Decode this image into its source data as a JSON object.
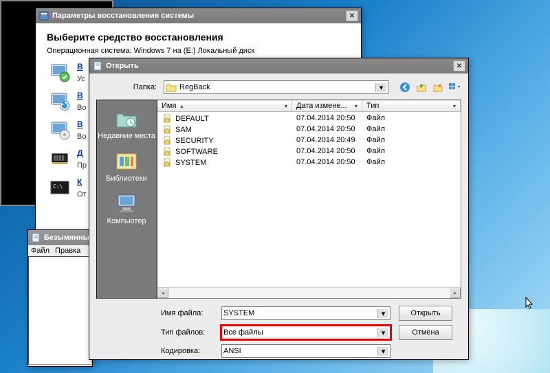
{
  "recovery": {
    "title": "Параметры восстановления системы",
    "heading": "Выберите средство восстановления",
    "os_line": "Операционная система: Windows 7 на (E:) Локальный диск",
    "items": [
      {
        "link": "В",
        "desc": "Ус"
      },
      {
        "link": "В",
        "desc": "Во"
      },
      {
        "link": "В",
        "desc": "Во"
      },
      {
        "link": "Д",
        "desc": "Пр"
      },
      {
        "link": "К",
        "desc": "От"
      }
    ]
  },
  "notepad": {
    "title": "Безымянны",
    "menu_file": "Файл",
    "menu_edit": "Правка"
  },
  "open": {
    "title": "Открыть",
    "folder_label": "Папка:",
    "folder_value": "RegBack",
    "places": {
      "recent": "Недавние места",
      "libraries": "Библиотеки",
      "computer": "Компьютер"
    },
    "columns": {
      "name": "Имя",
      "date": "Дата измене...",
      "type": "Тип"
    },
    "files": [
      {
        "name": "DEFAULT",
        "date": "07.04.2014 20:50",
        "type": "Файл"
      },
      {
        "name": "SAM",
        "date": "07.04.2014 20:50",
        "type": "Файл"
      },
      {
        "name": "SECURITY",
        "date": "07.04.2014 20:49",
        "type": "Файл"
      },
      {
        "name": "SOFTWARE",
        "date": "07.04.2014 20:50",
        "type": "Файл"
      },
      {
        "name": "SYSTEM",
        "date": "07.04.2014 20:50",
        "type": "Файл"
      }
    ],
    "filename_label": "Имя файла:",
    "filename_value": "SYSTEM",
    "filetype_label": "Тип файлов:",
    "filetype_value": "Все файлы",
    "encoding_label": "Кодировка:",
    "encoding_value": "ANSI",
    "open_btn": "Открыть",
    "cancel_btn": "Отмена"
  }
}
